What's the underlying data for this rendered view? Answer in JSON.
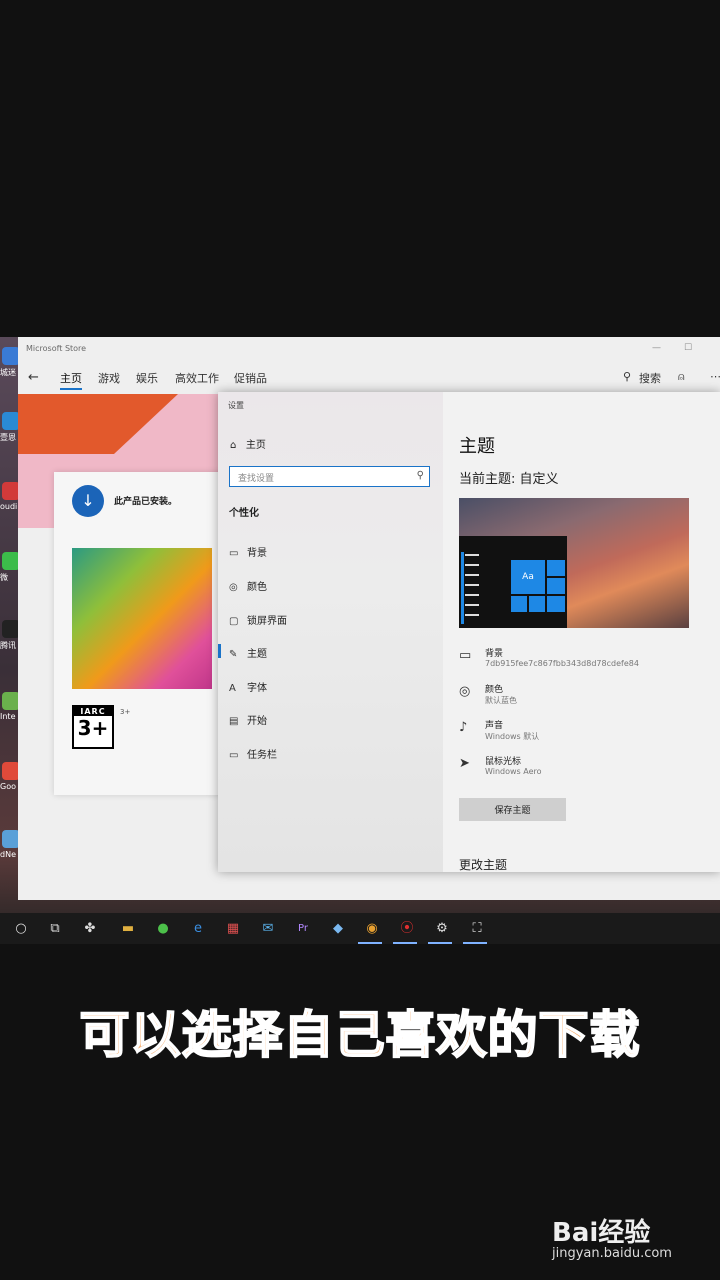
{
  "store": {
    "title": "Microsoft Store",
    "nav": [
      "主页",
      "游戏",
      "娱乐",
      "高效工作",
      "促销品"
    ],
    "search_label": "搜索",
    "installed_text": "此产品已安装。",
    "rating_top": "IARC",
    "rating_num": "3+",
    "rating_small": "3+"
  },
  "desktop_icons": [
    "城迷",
    "壹恩",
    "oudi",
    "微",
    "腾讯",
    "Inte Dow",
    "Goo Chro",
    "dNe"
  ],
  "settings": {
    "window_title": "设置",
    "home": "主页",
    "search_placeholder": "查找设置",
    "section": "个性化",
    "side_items": [
      "背景",
      "颜色",
      "锁屏界面",
      "主题",
      "字体",
      "开始",
      "任务栏"
    ],
    "active_item": "主题",
    "main_title": "主题",
    "current_theme": "当前主题: 自定义",
    "preview_tile": "Aa",
    "props": [
      {
        "name": "背景",
        "value": "7db915fee7c867fbb343d8d78cdefe84",
        "icon": "image-icon"
      },
      {
        "name": "颜色",
        "value": "默认蓝色",
        "icon": "palette-icon"
      },
      {
        "name": "声音",
        "value": "Windows 默认",
        "icon": "speaker-icon"
      },
      {
        "name": "鼠标光标",
        "value": "Windows Aero",
        "icon": "cursor-icon"
      }
    ],
    "save_button": "保存主题",
    "change_theme": "更改主题"
  },
  "taskbar_icons": [
    "cortana-icon",
    "task-view-icon",
    "pinwheel-icon",
    "explorer-icon",
    "wechat-icon",
    "edge-icon",
    "store-app-icon",
    "mail-icon",
    "premiere-icon",
    "app-icon",
    "chrome-icon",
    "record-icon",
    "settings-icon",
    "store-icon"
  ],
  "caption": "可以选择自己喜欢的下载",
  "watermark": {
    "logo": "Bai经验",
    "url": "jingyan.baidu.com"
  }
}
